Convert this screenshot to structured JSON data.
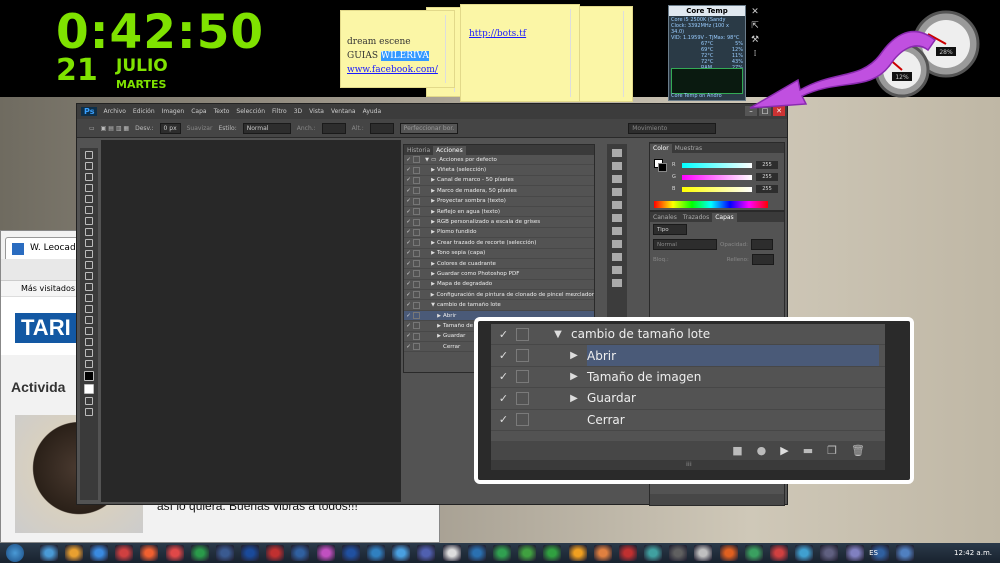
{
  "clock": {
    "time": "0:42:50",
    "day": "21",
    "month": "JULIO",
    "weekday": "MARTES"
  },
  "notes": {
    "note1": {
      "line1": "dream escene",
      "line2_prefix": "GUIAS ",
      "line2_highlight": "WILERIVA",
      "line3": "www.facebook.com/"
    },
    "note3": {
      "link": "http://bots.tf"
    }
  },
  "coretemp": {
    "title": "Core Temp",
    "model": "Core i5 2500K (Sandy",
    "clock": "Clock: 3392MHz (100 x 34.0)",
    "vid": "VID: 1.1959V - TjMax: 98°C",
    "temps": [
      "67°C",
      "69°C",
      "72°C",
      "72°C"
    ],
    "loads": [
      "5%",
      "12%",
      "11%",
      "43%"
    ],
    "ram": "RAM",
    "ram_value": "27%",
    "footer": "Core Temp on Andro"
  },
  "gauges": {
    "cpu": "28%",
    "mem": "12%"
  },
  "photoshop": {
    "logo": "Ps",
    "menu": [
      "Archivo",
      "Edición",
      "Imagen",
      "Capa",
      "Texto",
      "Selección",
      "Filtro",
      "3D",
      "Vista",
      "Ventana",
      "Ayuda"
    ],
    "options": {
      "desv_label": "Desv.:",
      "desv_value": "0 px",
      "suavizar": "Suavizar",
      "estilo_label": "Estilo:",
      "estilo_value": "Normal",
      "anch": "Anch.:",
      "alt": "Alt.:",
      "refine": "Perfeccionar bor.",
      "workspace": "Movimiento"
    },
    "actions_tabs": [
      "Historia",
      "Acciones"
    ],
    "actions": [
      {
        "label": "Acciones por defecto",
        "type": "folder"
      },
      {
        "label": "Viñeta (selección)"
      },
      {
        "label": "Canal de marco - 50 píxeles"
      },
      {
        "label": "Marco de madera, 50 píxeles"
      },
      {
        "label": "Proyectar sombra (texto)"
      },
      {
        "label": "Reflejo en agua (texto)"
      },
      {
        "label": "RGB personalizado a escala de grises"
      },
      {
        "label": "Plomo fundido"
      },
      {
        "label": "Crear trazado de recorte (selección)"
      },
      {
        "label": "Tono sepia (capa)"
      },
      {
        "label": "Colores de cuadrante"
      },
      {
        "label": "Guardar como Photoshop PDF"
      },
      {
        "label": "Mapa de degradado"
      },
      {
        "label": "Configuración de pintura de clonado de pincel mezclador"
      },
      {
        "label": "cambio de tamaño lote",
        "type": "open"
      },
      {
        "label": "Abrir",
        "type": "sub",
        "selected": true
      },
      {
        "label": "Tamaño de imagen",
        "type": "sub"
      },
      {
        "label": "Guardar",
        "type": "sub"
      },
      {
        "label": "Cerrar",
        "type": "subleaf"
      }
    ],
    "color_tabs": [
      "Color",
      "Muestras"
    ],
    "color": {
      "r_label": "R",
      "g_label": "G",
      "b_label": "B",
      "r": "255",
      "g": "255",
      "b": "255"
    },
    "layers_tabs": [
      "Canales",
      "Trazados",
      "Capas"
    ],
    "layers": {
      "kind": "Tipo",
      "mode": "Normal",
      "opacity_label": "Opacidad:",
      "lock_label": "Bloq.:",
      "fill_label": "Relleno:"
    }
  },
  "zoom": {
    "rows": [
      {
        "label": "cambio de tamaño lote",
        "type": "open"
      },
      {
        "label": "Abrir",
        "type": "sub",
        "selected": true
      },
      {
        "label": "Tamaño de imagen",
        "type": "sub"
      },
      {
        "label": "Guardar",
        "type": "sub"
      },
      {
        "label": "Cerrar",
        "type": "leaf"
      }
    ]
  },
  "browser": {
    "tab_title": "W. Leocadi",
    "bookmarks": "Más visitados",
    "banner": "TARI",
    "heading": "Activida",
    "text": "así lo quiera. Buenas vibras a todos!!!"
  },
  "taskbar": {
    "lang": "ES",
    "time": "12:42 a.m."
  }
}
